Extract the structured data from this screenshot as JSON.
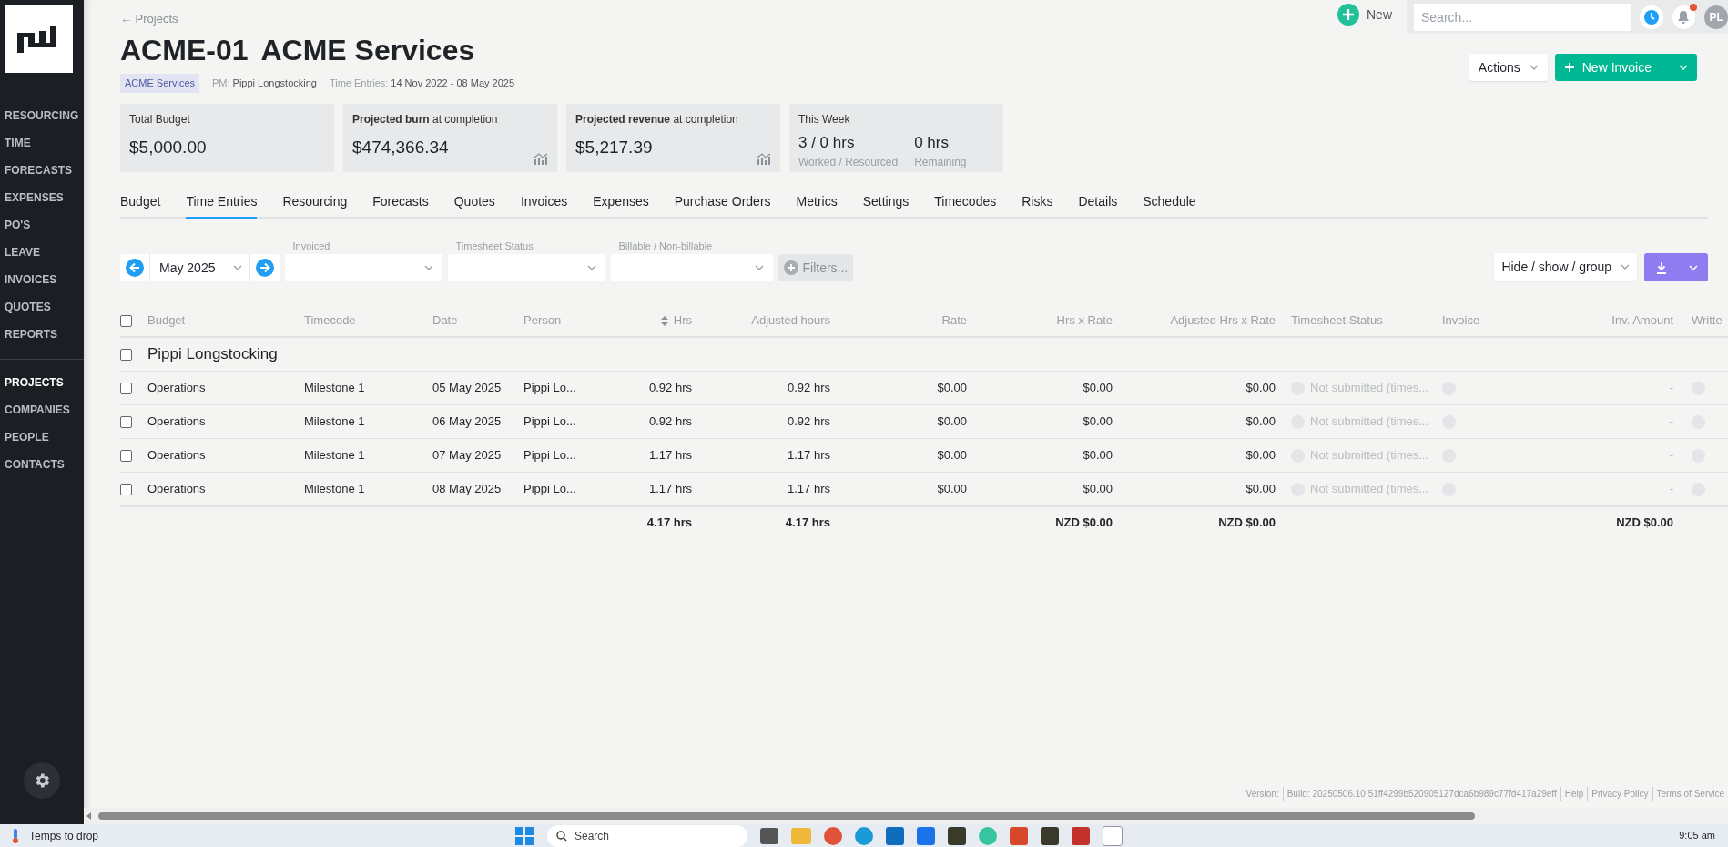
{
  "sidebar": {
    "modules": [
      {
        "label": "RESOURCING",
        "selected": false
      },
      {
        "label": "TIME",
        "selected": false
      },
      {
        "label": "FORECASTS",
        "selected": false
      },
      {
        "label": "EXPENSES",
        "selected": false
      },
      {
        "label": "PO'S",
        "selected": false
      },
      {
        "label": "LEAVE",
        "selected": false
      },
      {
        "label": "INVOICES",
        "selected": false
      },
      {
        "label": "QUOTES",
        "selected": false
      },
      {
        "label": "REPORTS",
        "selected": false
      }
    ],
    "records": [
      {
        "label": "PROJECTS",
        "selected": true
      },
      {
        "label": "COMPANIES",
        "selected": false
      },
      {
        "label": "PEOPLE",
        "selected": false
      },
      {
        "label": "CONTACTS",
        "selected": false
      }
    ]
  },
  "top_bar": {
    "new_label": "New",
    "search": {
      "placeholder": "Search..."
    },
    "avatar": "PL",
    "has_notification": true
  },
  "header": {
    "back_link": "← Projects",
    "code": "ACME-01",
    "name": "ACME Services",
    "client_tag": "ACME Services",
    "pm_label": "PM:",
    "pm": "Pippi Longstocking",
    "entries_label": "Time Entries:",
    "entries_range": "14 Nov 2022 - 08 May 2025",
    "actions": "Actions",
    "new_invoice": "New Invoice"
  },
  "cards": [
    {
      "kind": "single",
      "title": "Total Budget",
      "value": "$5,000.00",
      "chart_icon": false
    },
    {
      "kind": "single",
      "title": "**Projected burn** at completion",
      "value": "$474,366.34",
      "chart_icon": true
    },
    {
      "kind": "single",
      "title": "**Projected revenue** at completion",
      "value": "$5,217.39",
      "chart_icon": true
    },
    {
      "kind": "split",
      "title": "This Week",
      "stats": [
        {
          "value": "3 / 0 hrs",
          "caption": "Worked / Resourced"
        },
        {
          "value": "0 hrs",
          "caption": "Remaining"
        }
      ]
    }
  ],
  "tabs": [
    {
      "label": "Budget",
      "selected": false
    },
    {
      "label": "Time Entries",
      "selected": true
    },
    {
      "label": "Resourcing",
      "selected": false
    },
    {
      "label": "Forecasts",
      "selected": false
    },
    {
      "label": "Quotes",
      "selected": false
    },
    {
      "label": "Invoices",
      "selected": false
    },
    {
      "label": "Expenses",
      "selected": false
    },
    {
      "label": "Purchase Orders",
      "selected": false
    },
    {
      "label": "Metrics",
      "selected": false
    },
    {
      "label": "Settings",
      "selected": false
    },
    {
      "label": "Timecodes",
      "selected": false
    },
    {
      "label": "Risks",
      "selected": false
    },
    {
      "label": "Details",
      "selected": false
    },
    {
      "label": "Schedule",
      "selected": false
    }
  ],
  "filters": {
    "period": "May 2025",
    "dropdowns": [
      {
        "label": "Invoiced"
      },
      {
        "label": "Timesheet Status"
      },
      {
        "label": "Billable / Non-billable"
      }
    ],
    "filters_button": "Filters...",
    "hide_show": "Hide / show / group"
  },
  "table": {
    "select_all": {
      "checked": false
    },
    "columns": [
      {
        "label": "Budget",
        "kind": "text",
        "sortable": false
      },
      {
        "label": "Timecode",
        "kind": "text",
        "sortable": false
      },
      {
        "label": "Date",
        "kind": "text",
        "sortable": false
      },
      {
        "label": "Person",
        "kind": "text",
        "sortable": false
      },
      {
        "label": "Hrs",
        "kind": "number",
        "sortable": true,
        "total": "4.17 hrs"
      },
      {
        "label": "Adjusted hours",
        "kind": "number",
        "sortable": false,
        "total": "4.17 hrs"
      },
      {
        "label": "Rate",
        "kind": "number",
        "sortable": false
      },
      {
        "label": "Hrs x Rate",
        "kind": "number",
        "sortable": false,
        "total": "NZD $0.00"
      },
      {
        "label": "Adjusted Hrs x Rate",
        "kind": "number",
        "sortable": false,
        "total": "NZD $0.00"
      },
      {
        "label": "Timesheet Status",
        "kind": "status",
        "sortable": false
      },
      {
        "label": "Invoice",
        "kind": "dot",
        "sortable": false
      },
      {
        "label": "Inv. Amount",
        "kind": "number",
        "sortable": false,
        "total": "NZD $0.00"
      },
      {
        "label": "Writte",
        "kind": "dot",
        "sortable": false
      }
    ],
    "group": {
      "name": "Pippi Longstocking",
      "checked": false
    },
    "rows": [
      {
        "checked": false,
        "cells": [
          "Operations",
          "Milestone 1",
          "05 May 2025",
          "Pippi Lo...",
          "0.92 hrs",
          "0.92 hrs",
          "$0.00",
          "$0.00",
          "$0.00",
          "Not submitted (times...",
          "-"
        ]
      },
      {
        "checked": false,
        "cells": [
          "Operations",
          "Milestone 1",
          "06 May 2025",
          "Pippi Lo...",
          "0.92 hrs",
          "0.92 hrs",
          "$0.00",
          "$0.00",
          "$0.00",
          "Not submitted (times...",
          "-"
        ]
      },
      {
        "checked": false,
        "cells": [
          "Operations",
          "Milestone 1",
          "07 May 2025",
          "Pippi Lo...",
          "1.17 hrs",
          "1.17 hrs",
          "$0.00",
          "$0.00",
          "$0.00",
          "Not submitted (times...",
          "-"
        ]
      },
      {
        "checked": false,
        "cells": [
          "Operations",
          "Milestone 1",
          "08 May 2025",
          "Pippi Lo...",
          "1.17 hrs",
          "1.17 hrs",
          "$0.00",
          "$0.00",
          "$0.00",
          "Not submitted (times...",
          "-"
        ]
      }
    ]
  },
  "footer": {
    "version": "Version:",
    "build": "Build: 20250506.10 51ff4299b520905127dca6b989c77fd417a29eff",
    "links": [
      "Help",
      "Privacy Policy",
      "Terms of Service"
    ]
  },
  "taskbar": {
    "weather": "Temps to drop",
    "search_placeholder": "Search",
    "clock": "9:05 am"
  }
}
